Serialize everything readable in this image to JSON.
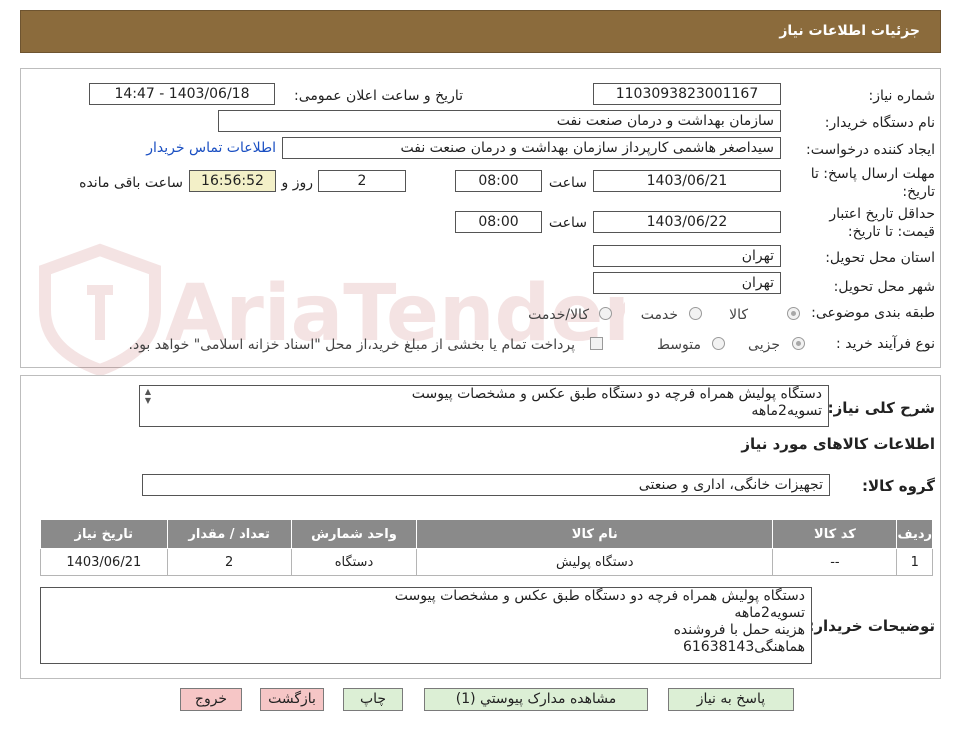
{
  "header": {
    "title": "جزئیات اطلاعات نیاز"
  },
  "watermark": {
    "text": "AriaTender.neT"
  },
  "form": {
    "need_number_label": "شماره نیاز:",
    "need_number": "1103093823001167",
    "announce_label": "تاریخ و ساعت اعلان عمومی:",
    "announce_value": "1403/06/18 - 14:47",
    "buyer_org_label": "نام دستگاه خریدار:",
    "buyer_org": "سازمان بهداشت و درمان صنعت نفت",
    "requester_label": "ایجاد کننده درخواست:",
    "requester": "سیداصغر هاشمی کارپرداز سازمان بهداشت و درمان صنعت نفت",
    "contact_link": "اطلاعات تماس خریدار",
    "reply_deadline_label_1": "مهلت ارسال پاسخ: تا",
    "reply_deadline_label_2": "تاریخ:",
    "reply_date": "1403/06/21",
    "time_label": "ساعت",
    "reply_time": "08:00",
    "days_value": "2",
    "days_label": "روز و",
    "remaining_time": "16:56:52",
    "remaining_label": "ساعت باقی مانده",
    "price_validity_label_1": "حداقل تاریخ اعتبار",
    "price_validity_label_2": "قیمت: تا تاریخ:",
    "price_date": "1403/06/22",
    "price_time": "08:00",
    "province_label": "استان محل تحویل:",
    "province": "تهران",
    "city_label": "شهر محل تحویل:",
    "city": "تهران",
    "category_label": "طبقه بندی موضوعی:",
    "category_options": [
      "کالا",
      "خدمت",
      "کالا/خدمت"
    ],
    "category_selected": "کالا",
    "process_label": "نوع فرآیند خرید :",
    "process_options": [
      "جزیی",
      "متوسط"
    ],
    "process_selected": "جزیی",
    "payment_note": "پرداخت تمام یا بخشی از مبلغ خرید،از محل \"اسناد خزانه اسلامی\" خواهد بود."
  },
  "details": {
    "summary_label": "شرح کلی نیاز:",
    "summary_lines": [
      "دستگاه پولیش همراه فرچه دو دستگاه طبق عکس و مشخصات پیوست",
      "تسویه2ماهه"
    ],
    "goods_info_title": "اطلاعات کالاهای مورد نیاز",
    "goods_group_label": "گروه کالا:",
    "goods_group": "تجهیزات خانگی، اداری و صنعتی",
    "table": {
      "headers": [
        "ردیف",
        "کد کالا",
        "نام کالا",
        "واحد شمارش",
        "تعداد / مقدار",
        "تاریخ نیاز"
      ],
      "rows": [
        [
          "1",
          "--",
          "دستگاه پولیش",
          "دستگاه",
          "2",
          "1403/06/21"
        ]
      ]
    },
    "buyer_notes_label": "توضیحات خریدار:",
    "buyer_notes_lines": [
      "دستگاه پولیش همراه فرچه دو دستگاه طبق عکس و مشخصات پیوست",
      "تسویه2ماهه",
      "هزینه حمل با فروشنده",
      "هماهنگی61638143"
    ]
  },
  "buttons": {
    "reply": "پاسخ به نیاز",
    "attachments": "مشاهده مدارک پیوستي (1)",
    "print": "چاپ",
    "back": "بازگشت",
    "exit": "خروج"
  }
}
